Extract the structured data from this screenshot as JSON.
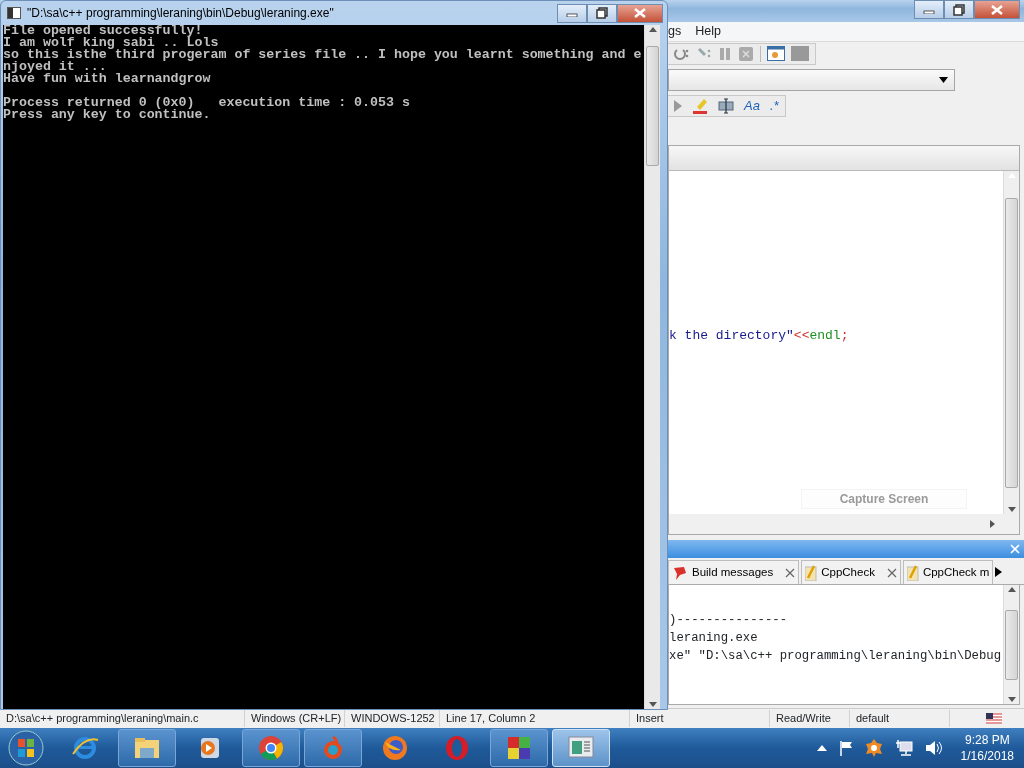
{
  "console": {
    "title": "\"D:\\sa\\c++ programming\\leraning\\bin\\Debug\\leraning.exe\"",
    "blocks": [
      [
        "File opened successfully!",
        "I am wolf king sabi .. Lols",
        "so this isthe third progeram of series file .. I hope you learnt something and e",
        "njoyed it ...",
        "Have fun with learnandgrow"
      ],
      [
        "Process returned 0 (0x0)   execution time : 0.053 s",
        "Press any key to continue."
      ]
    ]
  },
  "ide": {
    "menu": [
      "gs",
      "Help"
    ],
    "search_options": [
      "Aa",
      ".*"
    ],
    "code_line": [
      {
        "kind": "string",
        "text": "k the directory\""
      },
      {
        "kind": "operator",
        "text": "<<"
      },
      {
        "kind": "keyword",
        "text": "endl"
      },
      {
        "kind": "operator",
        "text": ";"
      }
    ],
    "capture_button": "Capture Screen",
    "log_tabs": [
      {
        "label": "Build messages",
        "kind": "build",
        "selected": false
      },
      {
        "label": "CppCheck",
        "kind": "note",
        "selected": false
      },
      {
        "label": "CppCheck m",
        "kind": "note",
        "selected": false
      }
    ],
    "log_lines": [
      ")---------------",
      "leraning.exe",
      "xe\" \"D:\\sa\\c++ programming\\leraning\\bin\\Debug"
    ],
    "status_bar": [
      "D:\\sa\\c++ programming\\leraning\\main.c",
      "Windows (CR+LF)",
      "WINDOWS-1252",
      "Line 17, Column 2",
      "Insert",
      "Read/Write",
      "default"
    ]
  },
  "taskbar": {
    "apps": [
      {
        "kind": "ie",
        "running": false,
        "active": false
      },
      {
        "kind": "explorer",
        "running": true,
        "active": false
      },
      {
        "kind": "media",
        "running": false,
        "active": false
      },
      {
        "kind": "chrome",
        "running": true,
        "active": false
      },
      {
        "kind": "swirl",
        "running": true,
        "active": false
      },
      {
        "kind": "firefox",
        "running": false,
        "active": false
      },
      {
        "kind": "opera",
        "running": false,
        "active": false
      },
      {
        "kind": "codeblocks",
        "running": true,
        "active": false
      },
      {
        "kind": "window",
        "running": true,
        "active": true
      }
    ],
    "clock": {
      "time": "9:28 PM",
      "date": "1/16/2018"
    }
  }
}
